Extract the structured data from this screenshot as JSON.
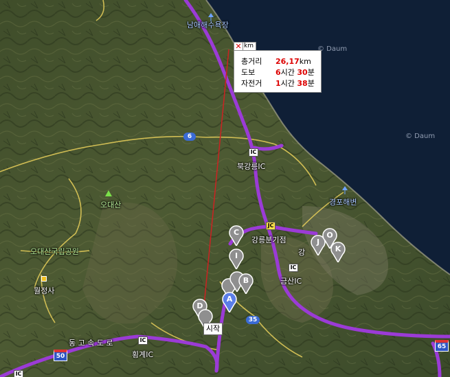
{
  "map": {
    "watermarks": [
      "© Daum",
      "© Daum"
    ],
    "place_labels": [
      {
        "id": "namae",
        "text": "남애해수욕장",
        "style": "blue"
      },
      {
        "id": "bukgangneung",
        "text": "북강릉IC",
        "style": "white"
      },
      {
        "id": "gyeongpo",
        "text": "경포해변",
        "style": "blue"
      },
      {
        "id": "odaesan",
        "text": "오대산",
        "style": "green"
      },
      {
        "id": "odaesan-park",
        "text": "오대산국립공원",
        "style": "green"
      },
      {
        "id": "woljeongsa",
        "text": "월정사",
        "style": "white"
      },
      {
        "id": "gangneung-jct",
        "text": "강릉분기점",
        "style": "white"
      },
      {
        "id": "gangneung",
        "text": "강",
        "style": "white"
      },
      {
        "id": "geumsan",
        "text": "금산IC",
        "style": "white"
      },
      {
        "id": "donghae-expy",
        "text": "동 고 속 도 로",
        "style": "white"
      },
      {
        "id": "hoenggye",
        "text": "횡계IC",
        "style": "white"
      }
    ],
    "road_shields": [
      {
        "id": "r6",
        "text": "6",
        "color": "#3a6bd6"
      },
      {
        "id": "r35",
        "text": "35",
        "color": "#3a6bd6"
      },
      {
        "id": "r50",
        "text": "50",
        "color": "#2e55c4"
      },
      {
        "id": "r65",
        "text": "65",
        "color": "#2e55c4"
      }
    ],
    "ic_badges": [
      "IC",
      "JC",
      "IC",
      "IC",
      "IC"
    ],
    "markers": [
      {
        "label": "C",
        "color": "#8f8f8f"
      },
      {
        "label": "I",
        "color": "#8f8f8f"
      },
      {
        "label": "B",
        "color": "#8f8f8f"
      },
      {
        "label": "A",
        "color": "#5b7ee8"
      },
      {
        "label": "D",
        "color": "#8f8f8f"
      },
      {
        "label": "J",
        "color": "#8f8f8f"
      },
      {
        "label": "O",
        "color": "#8f8f8f"
      },
      {
        "label": "K",
        "color": "#8f8f8f"
      }
    ]
  },
  "measure_popup": {
    "close_symbol": "✕",
    "unit_tab": "km",
    "rows": [
      {
        "key": "총거리",
        "parts": [
          {
            "text": "26,17",
            "num": true
          },
          {
            "text": "km",
            "num": false
          }
        ]
      },
      {
        "key": "도보",
        "parts": [
          {
            "text": "6",
            "num": true
          },
          {
            "text": "시간 ",
            "num": false
          },
          {
            "text": "30",
            "num": true
          },
          {
            "text": "분",
            "num": false
          }
        ]
      },
      {
        "key": "자전거",
        "parts": [
          {
            "text": "1",
            "num": true
          },
          {
            "text": "시간 ",
            "num": false
          },
          {
            "text": "38",
            "num": true
          },
          {
            "text": "분",
            "num": false
          }
        ]
      }
    ]
  },
  "start_label": "시작",
  "colors": {
    "sea": "#0f1f36",
    "highway": "#9b3bd6",
    "route_line": "#cc2222",
    "road_yellow": "#e8cf5a"
  }
}
